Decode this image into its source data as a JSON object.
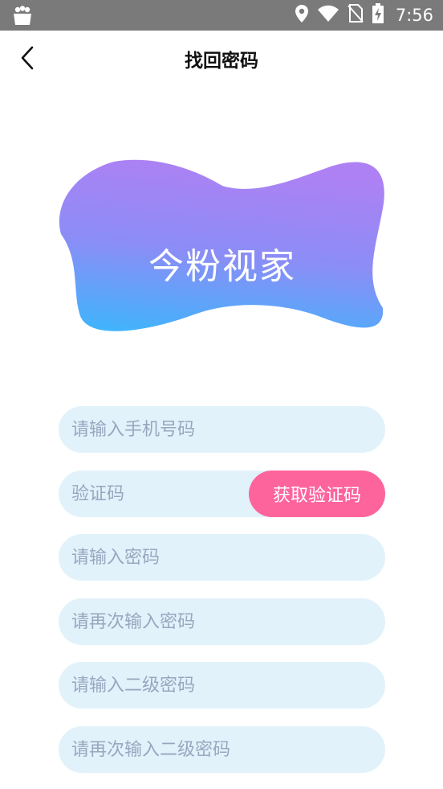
{
  "status_bar": {
    "time": "7:56",
    "icons": [
      "shopping-bag-icon",
      "location-pin-icon",
      "wifi-icon",
      "no-sim-icon",
      "battery-charging-icon"
    ]
  },
  "header": {
    "title": "找回密码",
    "back_icon": "chevron-left-icon"
  },
  "logo": {
    "text": "今粉视家",
    "gradient": [
      "#b07cf5",
      "#40b4fc"
    ]
  },
  "form": {
    "phone_placeholder": "请输入手机号码",
    "code_placeholder": "验证码",
    "code_button": "获取验证码",
    "password_placeholder": "请输入密码",
    "password_confirm_placeholder": "请再次输入密码",
    "secondary_password_placeholder": "请输入二级密码",
    "secondary_password_confirm_placeholder": "请再次输入二级密码"
  },
  "colors": {
    "status_bar": "#7a7a7a",
    "field_bg": "#e1f2fb",
    "placeholder": "#9aa6bf",
    "accent": "#fd649c"
  }
}
